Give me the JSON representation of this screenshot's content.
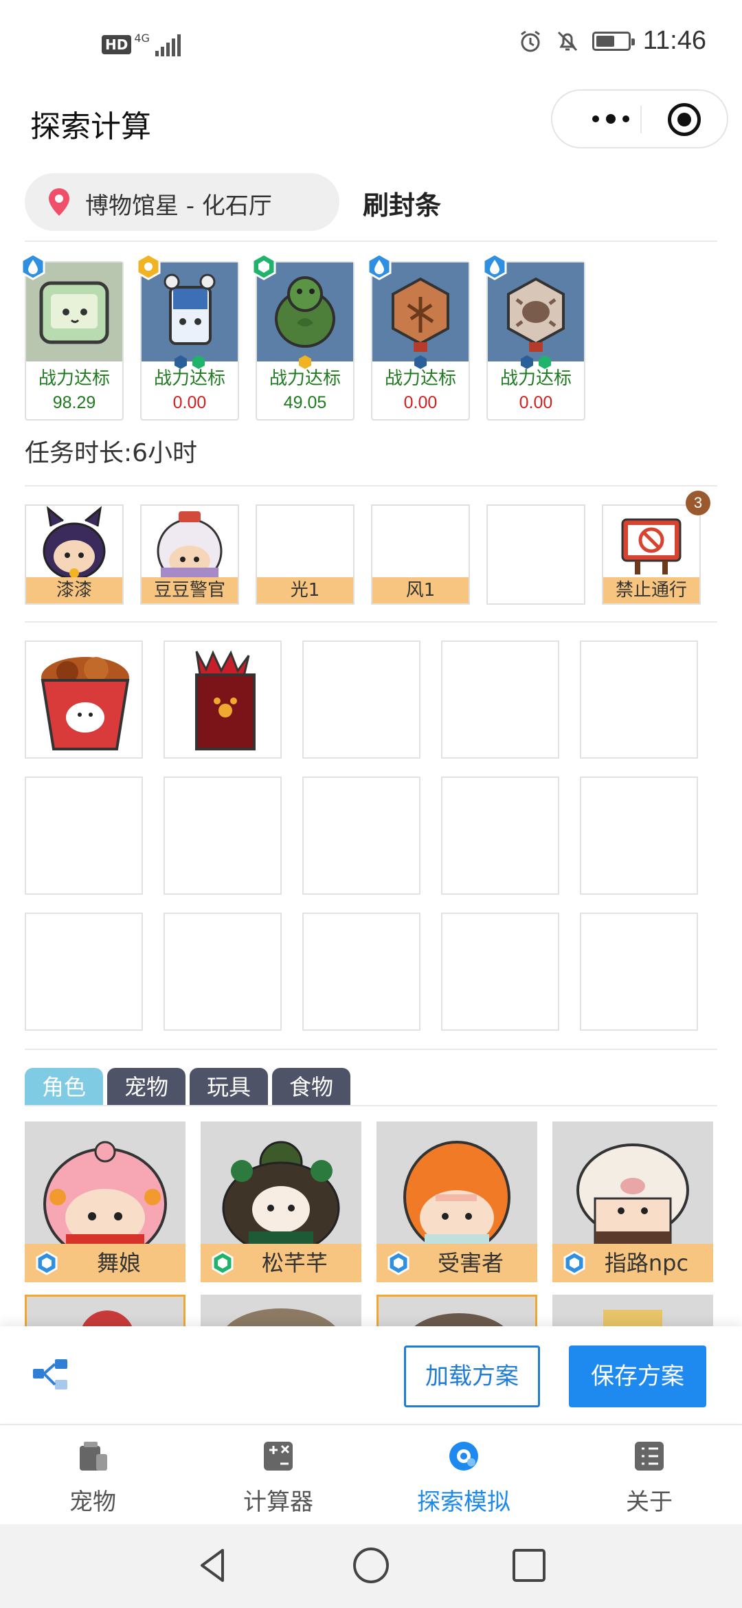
{
  "status_bar": {
    "hd": "HD",
    "network": "4G",
    "time": "11:46"
  },
  "header": {
    "title": "探索计算"
  },
  "location": {
    "place": "博物馆星 - 化石厅",
    "mode": "刷封条"
  },
  "pets": [
    {
      "label": "战力达标",
      "value": "98.29",
      "status": "ok",
      "element": "water"
    },
    {
      "label": "战力达标",
      "value": "0.00",
      "status": "bad",
      "element": "light"
    },
    {
      "label": "战力达标",
      "value": "49.05",
      "status": "ok",
      "element": "wood"
    },
    {
      "label": "战力达标",
      "value": "0.00",
      "status": "bad",
      "element": "water"
    },
    {
      "label": "战力达标",
      "value": "0.00",
      "status": "bad",
      "element": "water"
    }
  ],
  "duration": "任务时长:6小时",
  "characters": [
    {
      "name": "漆漆"
    },
    {
      "name": "豆豆警官"
    },
    {
      "name": "光1"
    },
    {
      "name": "风1"
    },
    {
      "name": ""
    },
    {
      "name": "禁止通行",
      "count": "3"
    }
  ],
  "tabs": [
    {
      "label": "角色",
      "active": true
    },
    {
      "label": "宠物",
      "active": false
    },
    {
      "label": "玩具",
      "active": false
    },
    {
      "label": "食物",
      "active": false
    }
  ],
  "picker": [
    {
      "name": "舞娘",
      "element": "water"
    },
    {
      "name": "松芊芊",
      "element": "wood"
    },
    {
      "name": "受害者",
      "element": "water"
    },
    {
      "name": "指路npc",
      "element": "water"
    }
  ],
  "actions": {
    "load": "加载方案",
    "save": "保存方案"
  },
  "tabbar": [
    {
      "label": "宠物",
      "icon": "pet-icon",
      "active": false
    },
    {
      "label": "计算器",
      "icon": "calculator-icon",
      "active": false
    },
    {
      "label": "探索模拟",
      "icon": "explore-icon",
      "active": true
    },
    {
      "label": "关于",
      "icon": "about-icon",
      "active": false
    }
  ],
  "colors": {
    "accent": "#1e8af0",
    "tab_active": "#7fcbe3",
    "tab_inactive": "#4e5368",
    "label_bg": "#f7c57f",
    "ok": "#1f7a1f",
    "bad": "#d21f1f"
  }
}
